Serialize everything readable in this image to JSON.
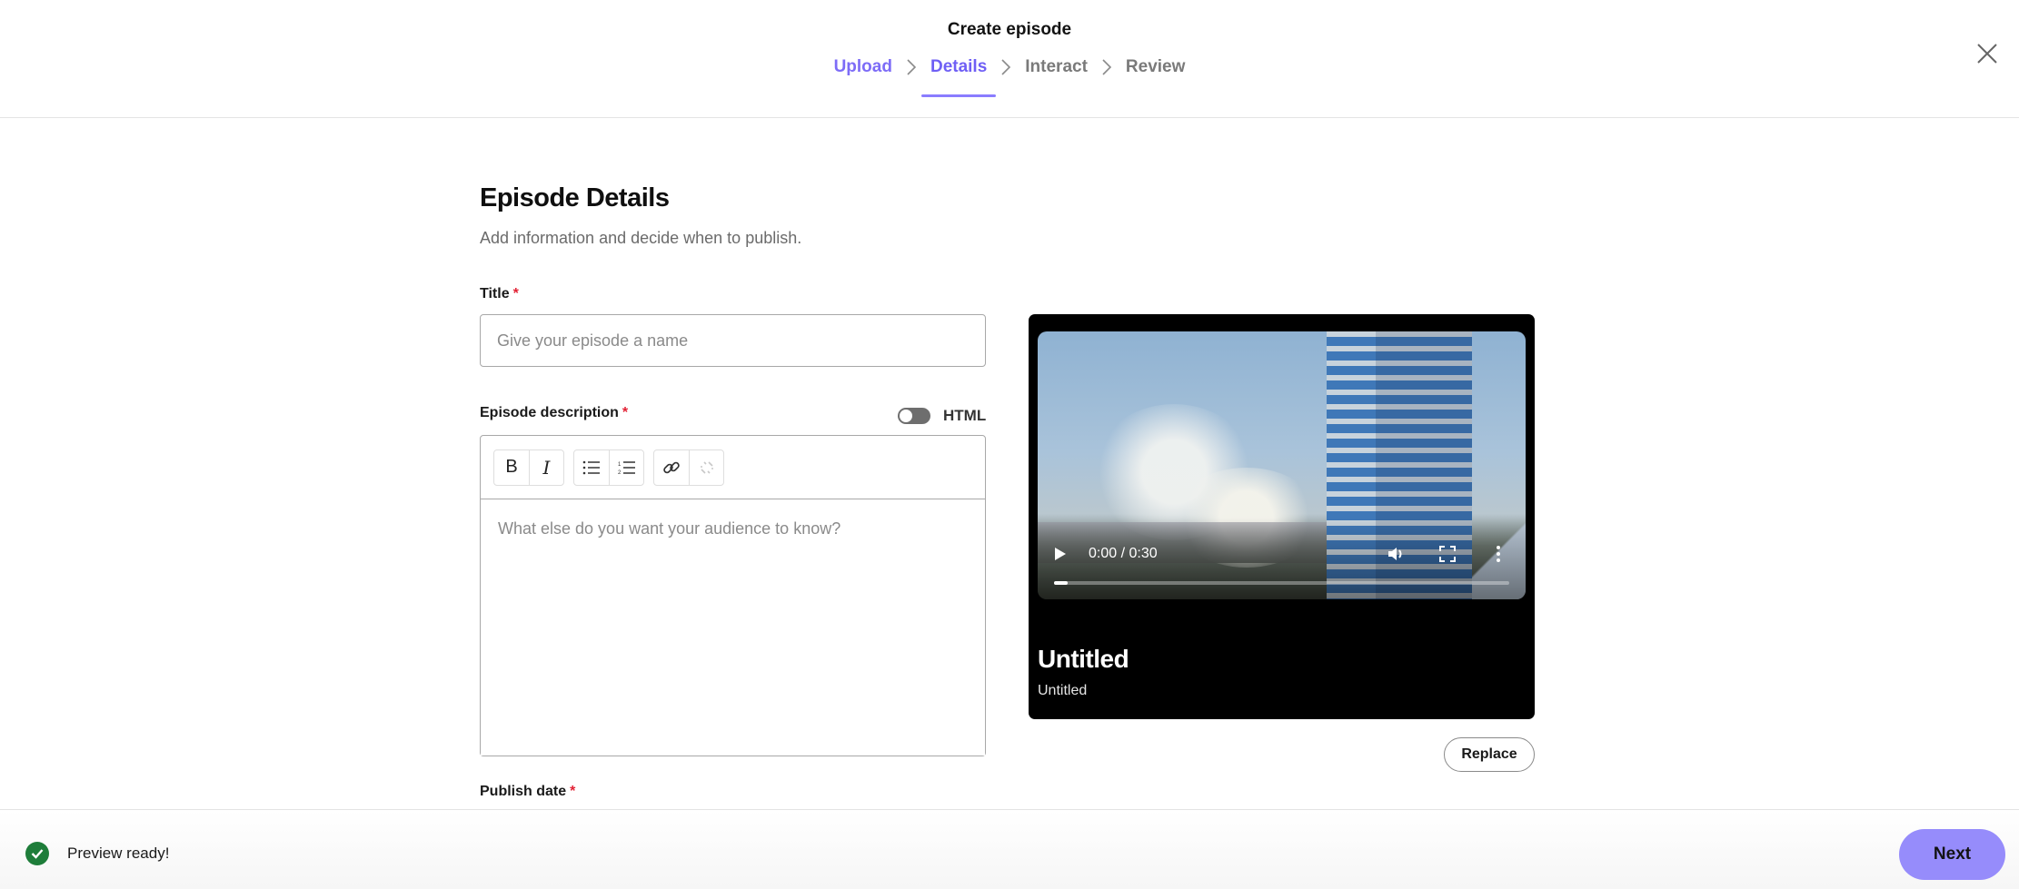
{
  "header": {
    "title": "Create episode",
    "steps": [
      {
        "label": "Upload",
        "state": "done"
      },
      {
        "label": "Details",
        "state": "active"
      },
      {
        "label": "Interact",
        "state": "upcoming"
      },
      {
        "label": "Review",
        "state": "upcoming"
      }
    ],
    "close_icon": "close-icon"
  },
  "main": {
    "title": "Episode Details",
    "subtitle": "Add information and decide when to publish.",
    "title_field": {
      "label": "Title",
      "required_mark": "*",
      "value": "",
      "placeholder": "Give your episode a name"
    },
    "description_field": {
      "label": "Episode description",
      "required_mark": "*",
      "html_toggle_label": "HTML",
      "html_toggle_on": false,
      "value": "",
      "placeholder": "What else do you want your audience to know?",
      "toolbar": [
        {
          "group": "format",
          "items": [
            {
              "icon": "bold-icon",
              "glyph": "B"
            },
            {
              "icon": "italic-icon",
              "glyph": "I"
            }
          ]
        },
        {
          "group": "lists",
          "items": [
            {
              "icon": "bulleted-list-icon"
            },
            {
              "icon": "numbered-list-icon"
            }
          ]
        },
        {
          "group": "links",
          "items": [
            {
              "icon": "link-icon"
            },
            {
              "icon": "unlink-icon",
              "disabled": true
            }
          ]
        }
      ]
    },
    "publish_date": {
      "label": "Publish date",
      "required_mark": "*"
    }
  },
  "preview": {
    "time_display": "0:00 / 0:30",
    "progress_percent": 3,
    "title": "Untitled",
    "subtitle": "Untitled",
    "replace_label": "Replace"
  },
  "footer": {
    "status_text": "Preview ready!",
    "status_color": "#1e7d3a",
    "next_label": "Next",
    "accent_color": "#968cfb"
  }
}
